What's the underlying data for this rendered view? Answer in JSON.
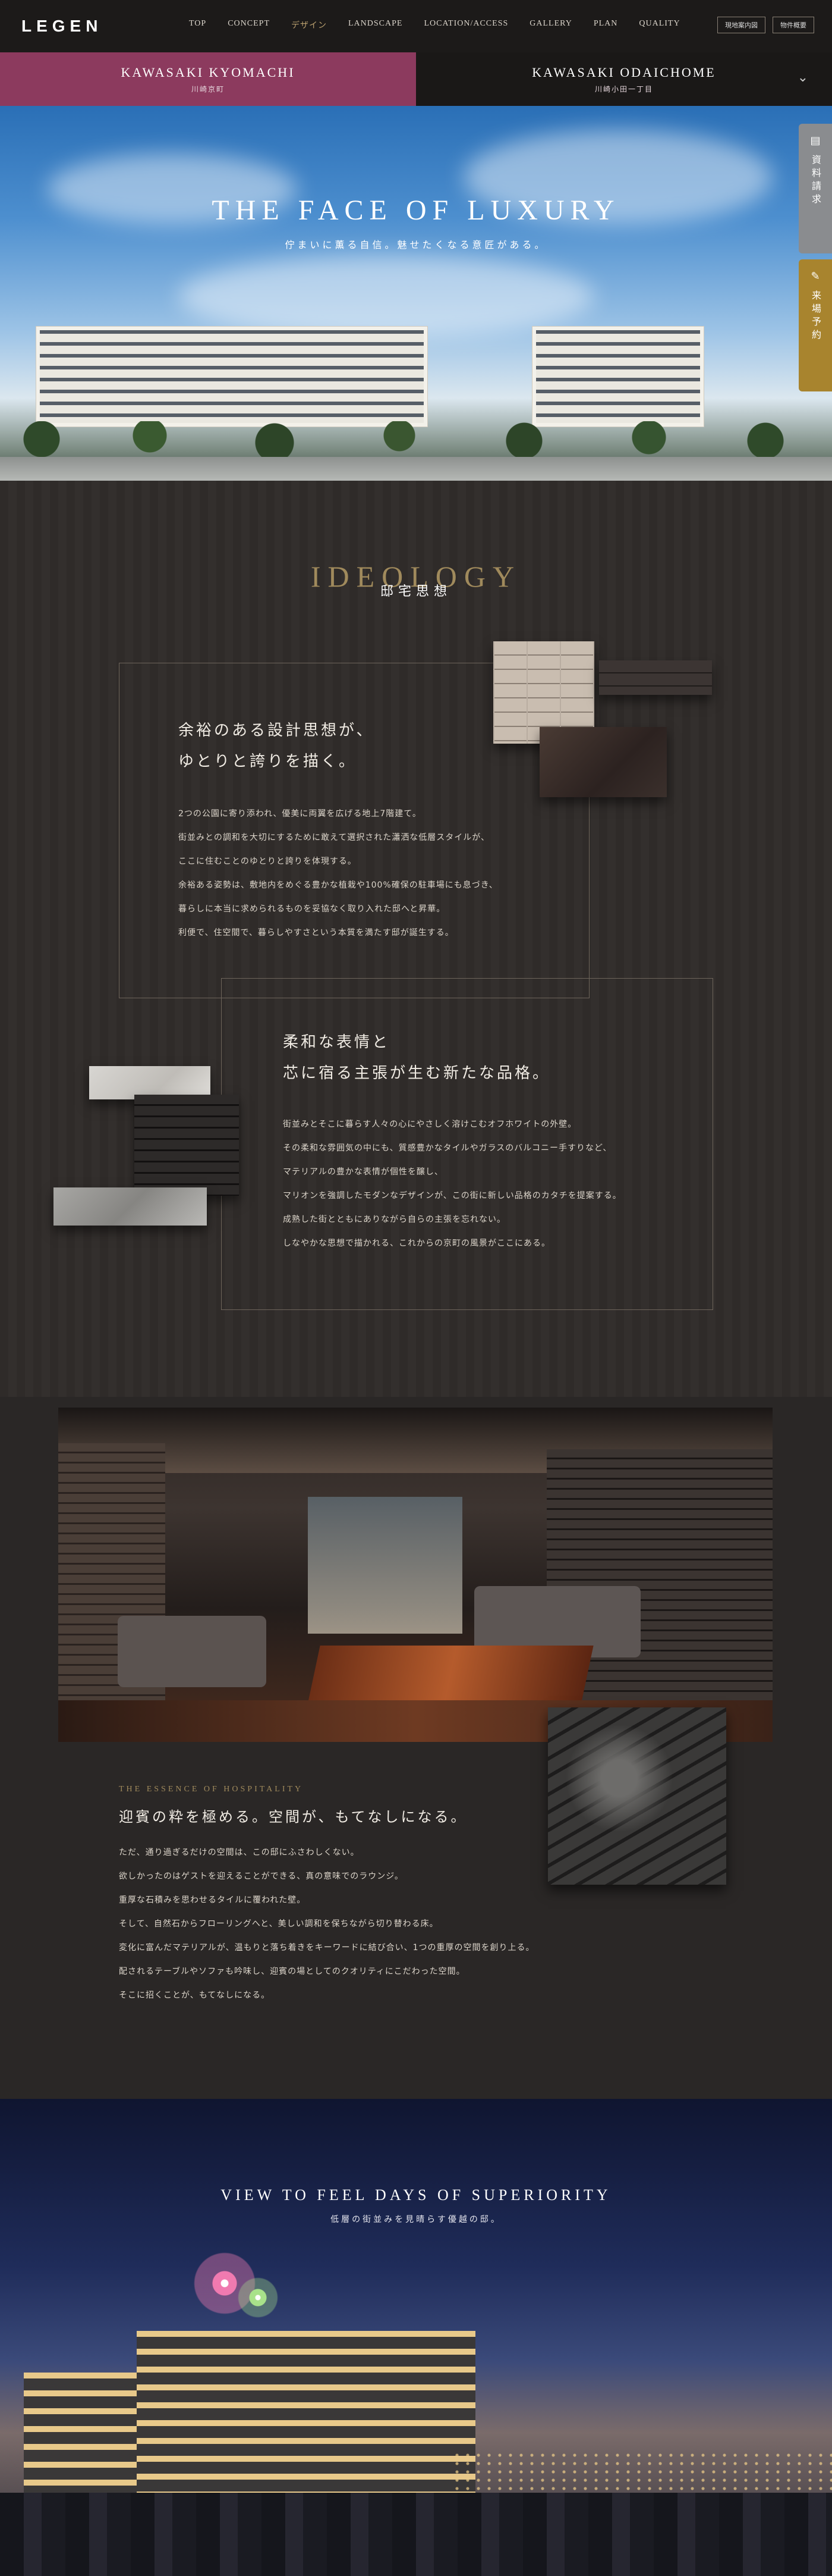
{
  "header": {
    "logo": "LEGEN",
    "nav": [
      "TOP",
      "CONCEPT",
      "デザイン",
      "LANDSCAPE",
      "LOCATION/ACCESS",
      "GALLERY",
      "PLAN",
      "QUALITY"
    ],
    "active_nav": "デザイン",
    "btn_current": "現地案内図",
    "btn_overview": "物件概要"
  },
  "property_tabs": [
    {
      "en": "KAWASAKI KYOMACHI",
      "ja": "川崎京町"
    },
    {
      "en": "KAWASAKI ODAICHOME",
      "ja": "川崎小田一丁目"
    }
  ],
  "hero": {
    "title": "THE FACE OF LUXURY",
    "subtitle": "佇まいに薫る自信。魅せたくなる意匠がある。"
  },
  "side_buttons": {
    "request": "資料請求",
    "visit": "来場予約"
  },
  "ideology": {
    "title": "IDEOLOGY",
    "subtitle": "邸宅思想",
    "block1": {
      "heading_line1": "余裕のある設計思想が、",
      "heading_line2": "ゆとりと誇りを描く。",
      "lines": [
        "2つの公園に寄り添われ、優美に両翼を広げる地上7階建て。",
        "街並みとの調和を大切にするために敢えて選択された瀟洒な低層スタイルが、",
        "ここに住むことのゆとりと誇りを体現する。",
        "余裕ある姿勢は、敷地内をめぐる豊かな植栽や100%確保の駐車場にも息づき、",
        "暮らしに本当に求められるものを妥協なく取り入れた邸へと昇華。",
        "利便で、住空間で、暮らしやすさという本質を満たす邸が誕生する。"
      ]
    },
    "block2": {
      "heading_line1": "柔和な表情と",
      "heading_line2": "芯に宿る主張が生む新たな品格。",
      "lines": [
        "街並みとそこに暮らす人々の心にやさしく溶けこむオフホワイトの外壁。",
        "その柔和な雰囲気の中にも、質感豊かなタイルやガラスのバルコニー手すりなど、",
        "マテリアルの豊かな表情が個性を醸し、",
        "マリオンを強調したモダンなデザインが、この街に新しい品格のカタチを提案する。",
        "成熟した街とともにありながら自らの主張を忘れない。",
        "しなやかな思想で描かれる、これからの京町の風景がここにある。"
      ]
    }
  },
  "hospitality": {
    "label": "THE ESSENCE OF HOSPITALITY",
    "heading": "迎賓の粋を極める。空間が、もてなしになる。",
    "lines": [
      "ただ、通り過ぎるだけの空間は、この邸にふさわしくない。",
      "欲しかったのはゲストを迎えることができる、真の意味でのラウンジ。",
      "重厚な石積みを思わせるタイルに覆われた壁。",
      "そして、自然石からフローリングへと、美しい調和を保ちながら切り替わる床。",
      "変化に富んだマテリアルが、温もりと落ち着きをキーワードに結び合い、1つの重厚の空間を創り上る。",
      "配されるテーブルやソファも吟味し、迎賓の場としてのクオリティにこだわった空間。",
      "そこに招くことが、もてなしになる。"
    ]
  },
  "night": {
    "title": "VIEW TO FEEL DAYS OF SUPERIORITY",
    "subtitle": "低層の街並みを見晴らす優越の邸。"
  },
  "colors": {
    "accent_gold": "#a08a5c",
    "tab_magenta": "#8c3a5e",
    "reserve_gold": "#a8842e"
  }
}
